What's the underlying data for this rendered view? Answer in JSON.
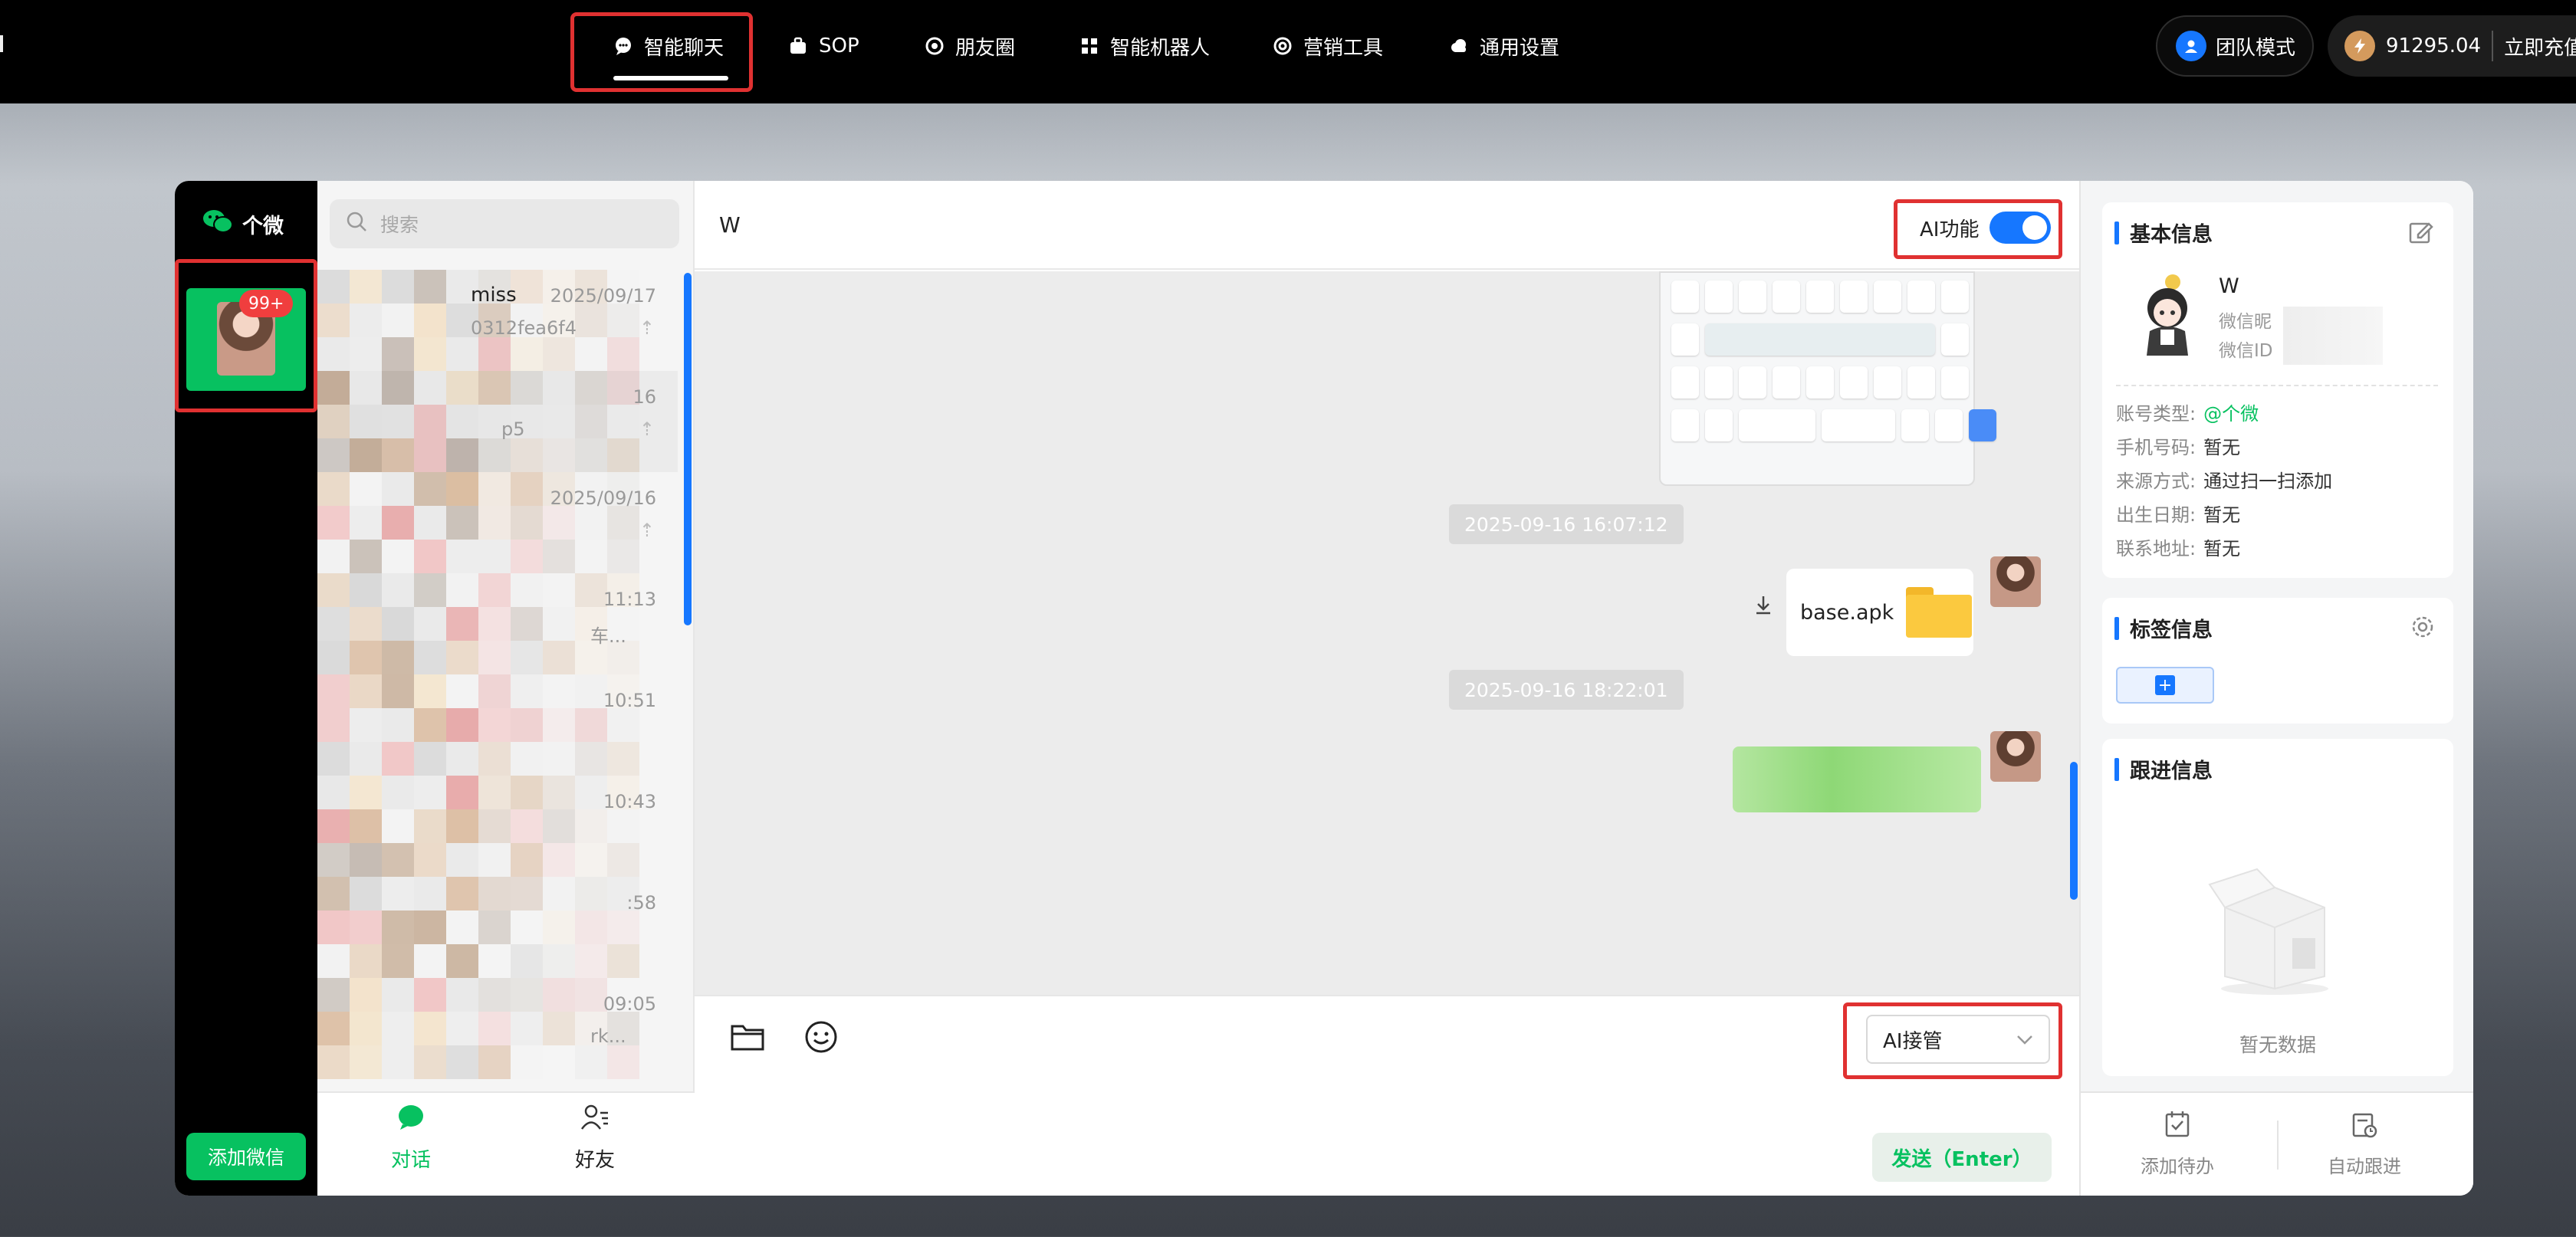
{
  "topnav": {
    "items": [
      {
        "label": "智能聊天",
        "icon": "chat-bubble-icon"
      },
      {
        "label": "SOP",
        "icon": "briefcase-icon"
      },
      {
        "label": "朋友圈",
        "icon": "aperture-icon"
      },
      {
        "label": "智能机器人",
        "icon": "grid-icon"
      },
      {
        "label": "营销工具",
        "icon": "target-icon"
      },
      {
        "label": "通用设置",
        "icon": "cloud-icon"
      }
    ],
    "team_mode": "团队模式",
    "balance": "91295.04",
    "recharge": "立即充值"
  },
  "leftbar": {
    "brand": "个微",
    "badge": "99+",
    "add_wechat": "添加微信"
  },
  "conversations": {
    "search_placeholder": "搜索",
    "items": [
      {
        "name": "miss",
        "time": "2025/09/17",
        "msg": "0312fea6f4"
      },
      {
        "name": "",
        "time": "16",
        "msg": "p5"
      },
      {
        "name": "",
        "time": "2025/09/16",
        "msg": ""
      },
      {
        "name": "",
        "time": "11:13",
        "msg": "车..."
      },
      {
        "name": "",
        "time": "10:51",
        "msg": ""
      },
      {
        "name": "",
        "time": "10:43",
        "msg": ""
      },
      {
        "name": "",
        "time": ":58",
        "msg": ""
      },
      {
        "name": "",
        "time": "09:05",
        "msg": "rk..."
      }
    ],
    "tabs": [
      {
        "label": "对话",
        "icon": "chat-bubble-icon"
      },
      {
        "label": "好友",
        "icon": "friends-icon"
      }
    ]
  },
  "chat": {
    "contact_name": "W",
    "ai_toggle_label": "AI功能",
    "timestamps": [
      "2025-09-16 16:07:12",
      "2025-09-16 18:22:01"
    ],
    "file_name": "base.apk",
    "mode_select": "AI接管",
    "send_button": "发送（Enter）"
  },
  "profile": {
    "basic_title": "基本信息",
    "name": "W",
    "nickname_label": "微信昵",
    "wxid_label": "微信ID",
    "fields": [
      {
        "label": "账号类型:",
        "value": "@个微"
      },
      {
        "label": "手机号码:",
        "value": "暂无"
      },
      {
        "label": "来源方式:",
        "value": "通过扫一扫添加"
      },
      {
        "label": "出生日期:",
        "value": "暂无"
      },
      {
        "label": "联系地址:",
        "value": "暂无"
      }
    ],
    "tags_title": "标签信息",
    "follow_title": "跟进信息",
    "empty_text": "暂无数据",
    "actions": [
      {
        "label": "添加待办",
        "icon": "todo-icon"
      },
      {
        "label": "自动跟进",
        "icon": "auto-follow-icon"
      }
    ]
  },
  "colors": {
    "accent": "#1677ff",
    "brand_green": "#07c160",
    "highlight_red": "#e03131"
  }
}
